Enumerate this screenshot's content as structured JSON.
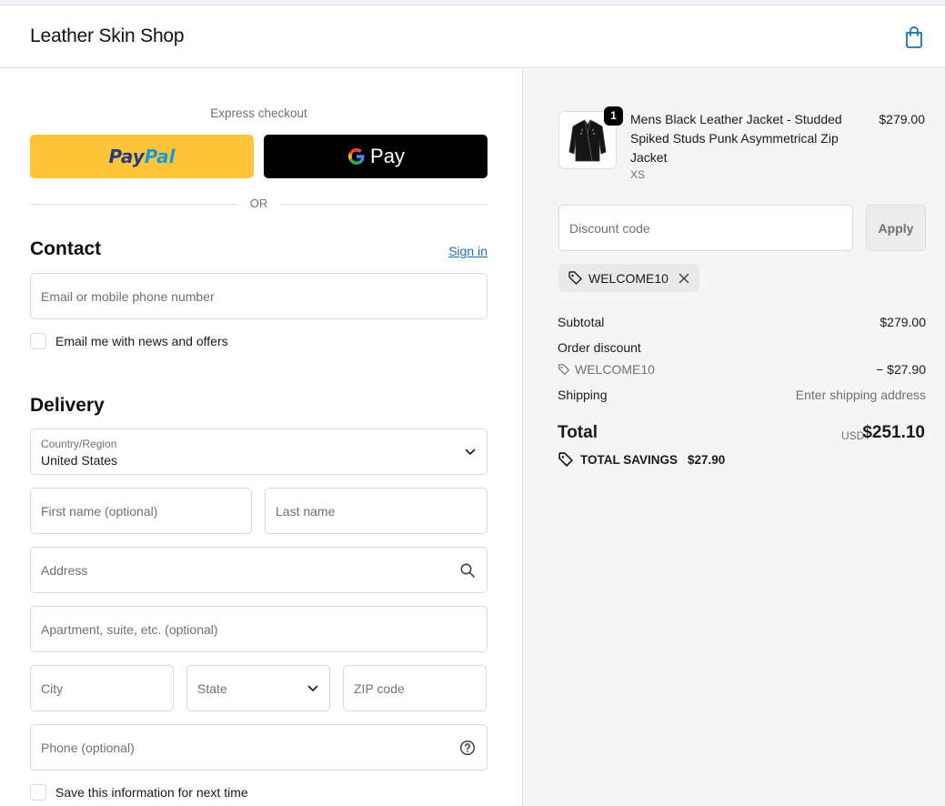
{
  "header": {
    "shop_name": "Leather Skin Shop",
    "cart_icon": "shopping-bag-icon"
  },
  "express": {
    "label": "Express checkout",
    "paypal": {
      "part1": "Pay",
      "part2": "Pal"
    },
    "gpay": {
      "g": "G",
      "pay": "Pay"
    },
    "or": "OR"
  },
  "contact": {
    "title": "Contact",
    "sign_in": "Sign in",
    "email_placeholder": "Email or mobile phone number",
    "news_label": "Email me with news and offers"
  },
  "delivery": {
    "title": "Delivery",
    "country_label": "Country/Region",
    "country_value": "United States",
    "first_name_placeholder": "First name (optional)",
    "last_name_placeholder": "Last name",
    "address_placeholder": "Address",
    "apartment_placeholder": "Apartment, suite, etc. (optional)",
    "city_placeholder": "City",
    "state_placeholder": "State",
    "zip_placeholder": "ZIP code",
    "phone_placeholder": "Phone (optional)",
    "save_label": "Save this information for next time"
  },
  "summary": {
    "product": {
      "name": "Mens Black Leather Jacket - Studded Spiked Studs Punk Asymmetrical Zip Jacket",
      "variant": "XS",
      "price": "$279.00",
      "quantity": "1"
    },
    "discount_placeholder": "Discount code",
    "apply": "Apply",
    "applied_code": "WELCOME10",
    "subtotal_label": "Subtotal",
    "subtotal_value": "$279.00",
    "order_discount_label": "Order discount",
    "order_discount_code": "WELCOME10",
    "order_discount_value": "− $27.90",
    "shipping_label": "Shipping",
    "shipping_value": "Enter shipping address",
    "total_label": "Total",
    "total_currency": "USD",
    "total_value": "$251.10",
    "savings_label": "TOTAL SAVINGS",
    "savings_value": "$27.90"
  }
}
